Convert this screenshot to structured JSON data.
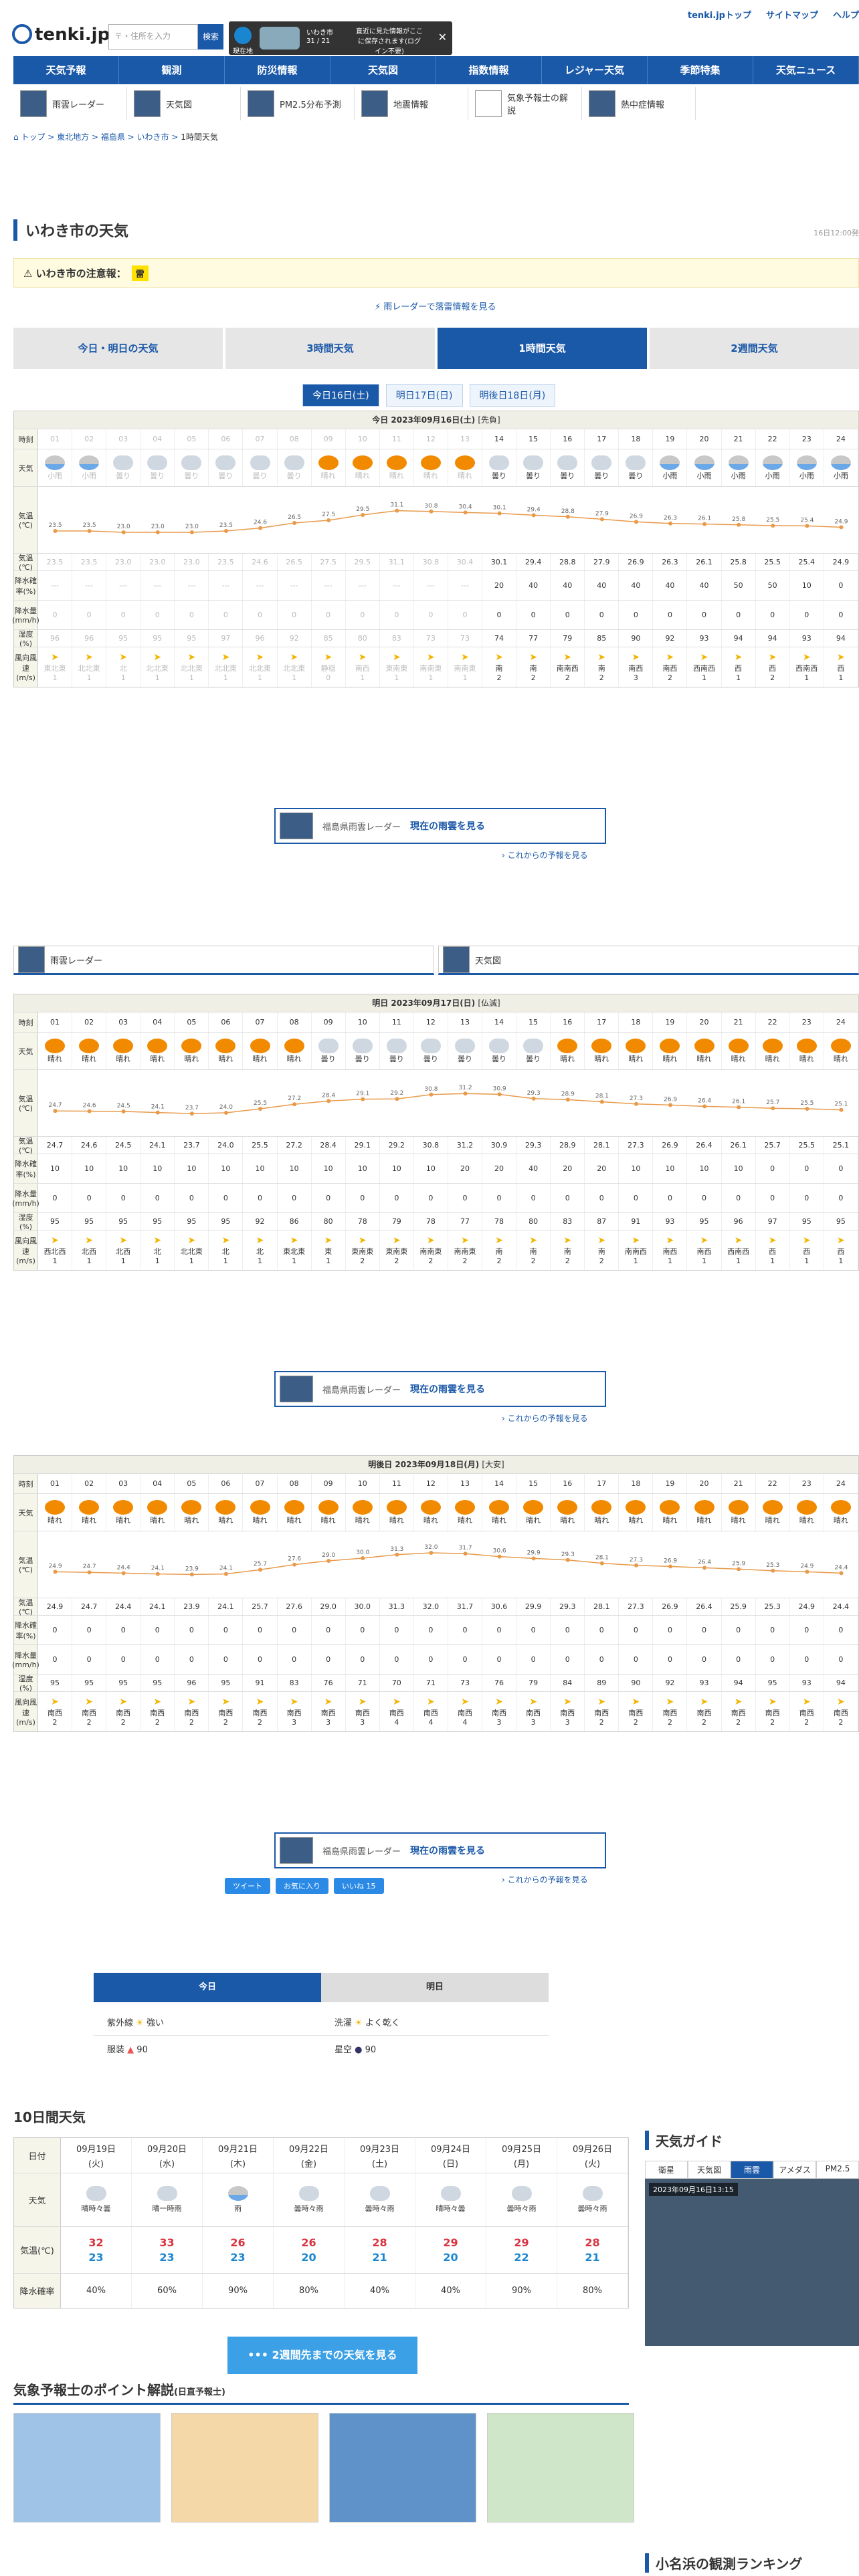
{
  "header": {
    "logo": "tenki.jp",
    "search_placeholder": "〒・住所を入力",
    "search_btn": "検索",
    "curloc_label": "現在地",
    "curloc_city": "いわき市",
    "curloc_temp": "31 / 21",
    "save_msg": "直近に見た情報がここに保存されます(ログイン不要)",
    "links": [
      "tenki.jpトップ",
      "サイトマップ",
      "ヘルプ"
    ]
  },
  "gnav": [
    "天気予報",
    "観測",
    "防災情報",
    "天気図",
    "指数情報",
    "レジャー天気",
    "季節特集",
    "天気ニュース"
  ],
  "snav": [
    "雨雲レーダー",
    "天気図",
    "PM2.5分布予測",
    "地震情報",
    "気象予報士の解説",
    "熱中症情報"
  ],
  "breadcrumb": [
    "トップ",
    "東北地方",
    "福島県",
    "いわき市",
    "1時間天気"
  ],
  "page": {
    "title": "いわき市の天気",
    "updated": "16日12:00発",
    "warn_label": "いわき市の注意報：",
    "warn_badge": "雷",
    "radar_link": "雨レーダーで落雷情報を見る"
  },
  "tabs": [
    "今日・明日の天気",
    "3時間天気",
    "1時間天気",
    "2週間天気"
  ],
  "day_tabs": [
    "今日16日(土)",
    "明日17日(日)",
    "明後日18日(月)"
  ],
  "row_labels": {
    "time": "時刻",
    "weather": "天気",
    "temp": "気温(℃)",
    "prob": "降水確率(%)",
    "precip": "降水量(mm/h)",
    "humid": "湿度(%)",
    "wind": "風向風速(m/s)"
  },
  "hours": [
    "01",
    "02",
    "03",
    "04",
    "05",
    "06",
    "07",
    "08",
    "09",
    "10",
    "11",
    "12",
    "13",
    "14",
    "15",
    "16",
    "17",
    "18",
    "19",
    "20",
    "21",
    "22",
    "23",
    "24"
  ],
  "days": [
    {
      "title": "今日 2023年09月16日(土)",
      "rokuyo": "[先負]",
      "past_until": 13,
      "weather": [
        "小雨",
        "小雨",
        "曇り",
        "曇り",
        "曇り",
        "曇り",
        "曇り",
        "曇り",
        "晴れ",
        "晴れ",
        "晴れ",
        "晴れ",
        "晴れ",
        "曇り",
        "曇り",
        "曇り",
        "曇り",
        "曇り",
        "小雨",
        "小雨",
        "小雨",
        "小雨",
        "小雨",
        "小雨"
      ],
      "temp": [
        "23.5",
        "23.5",
        "23.0",
        "23.0",
        "23.0",
        "23.5",
        "24.6",
        "26.5",
        "27.5",
        "29.5",
        "31.1",
        "30.8",
        "30.4",
        "30.1",
        "29.4",
        "28.8",
        "27.9",
        "26.9",
        "26.3",
        "26.1",
        "25.8",
        "25.5",
        "25.4",
        "24.9"
      ],
      "prob": [
        "---",
        "---",
        "---",
        "---",
        "---",
        "---",
        "---",
        "---",
        "---",
        "---",
        "---",
        "---",
        "---",
        "20",
        "40",
        "40",
        "40",
        "40",
        "40",
        "40",
        "50",
        "50",
        "10",
        "0"
      ],
      "precip": [
        "0",
        "0",
        "0",
        "0",
        "0",
        "0",
        "0",
        "0",
        "0",
        "0",
        "0",
        "0",
        "0",
        "0",
        "0",
        "0",
        "0",
        "0",
        "0",
        "0",
        "0",
        "0",
        "0",
        "0"
      ],
      "humid": [
        "96",
        "96",
        "95",
        "95",
        "95",
        "97",
        "96",
        "92",
        "85",
        "80",
        "83",
        "73",
        "73",
        "74",
        "77",
        "79",
        "85",
        "90",
        "92",
        "93",
        "94",
        "94",
        "93",
        "94"
      ],
      "wdir": [
        "東北東",
        "北北東",
        "北",
        "北北東",
        "北北東",
        "北北東",
        "北北東",
        "北北東",
        "静穏",
        "南西",
        "東南東",
        "南南東",
        "南南東",
        "南",
        "南",
        "南南西",
        "南",
        "南西",
        "南西",
        "西南西",
        "西",
        "西",
        "西南西",
        "西"
      ],
      "wspd": [
        "1",
        "1",
        "1",
        "1",
        "1",
        "1",
        "1",
        "1",
        "0",
        "1",
        "1",
        "1",
        "1",
        "2",
        "2",
        "2",
        "2",
        "3",
        "2",
        "1",
        "1",
        "2",
        "1",
        "1"
      ]
    },
    {
      "title": "明日 2023年09月17日(日)",
      "rokuyo": "[仏滅]",
      "past_until": 0,
      "weather": [
        "晴れ",
        "晴れ",
        "晴れ",
        "晴れ",
        "晴れ",
        "晴れ",
        "晴れ",
        "晴れ",
        "曇り",
        "曇り",
        "曇り",
        "曇り",
        "曇り",
        "曇り",
        "曇り",
        "晴れ",
        "晴れ",
        "晴れ",
        "晴れ",
        "晴れ",
        "晴れ",
        "晴れ",
        "晴れ",
        "晴れ"
      ],
      "temp": [
        "24.7",
        "24.6",
        "24.5",
        "24.1",
        "23.7",
        "24.0",
        "25.5",
        "27.2",
        "28.4",
        "29.1",
        "29.2",
        "30.8",
        "31.2",
        "30.9",
        "29.3",
        "28.9",
        "28.1",
        "27.3",
        "26.9",
        "26.4",
        "26.1",
        "25.7",
        "25.5",
        "25.1"
      ],
      "prob": [
        "10",
        "10",
        "10",
        "10",
        "10",
        "10",
        "10",
        "10",
        "10",
        "10",
        "10",
        "10",
        "20",
        "20",
        "40",
        "20",
        "20",
        "10",
        "10",
        "10",
        "10",
        "0",
        "0",
        "0"
      ],
      "precip": [
        "0",
        "0",
        "0",
        "0",
        "0",
        "0",
        "0",
        "0",
        "0",
        "0",
        "0",
        "0",
        "0",
        "0",
        "0",
        "0",
        "0",
        "0",
        "0",
        "0",
        "0",
        "0",
        "0",
        "0"
      ],
      "humid": [
        "95",
        "95",
        "95",
        "95",
        "95",
        "95",
        "92",
        "86",
        "80",
        "78",
        "79",
        "78",
        "77",
        "78",
        "80",
        "83",
        "87",
        "91",
        "93",
        "95",
        "96",
        "97",
        "95",
        "95"
      ],
      "wdir": [
        "西北西",
        "北西",
        "北西",
        "北",
        "北北東",
        "北",
        "北",
        "東北東",
        "東",
        "東南東",
        "東南東",
        "南南東",
        "南南東",
        "南",
        "南",
        "南",
        "南",
        "南南西",
        "南西",
        "南西",
        "西南西",
        "西",
        "西",
        "西"
      ],
      "wspd": [
        "1",
        "1",
        "1",
        "1",
        "1",
        "1",
        "1",
        "1",
        "1",
        "2",
        "2",
        "2",
        "2",
        "2",
        "2",
        "2",
        "2",
        "1",
        "1",
        "1",
        "1",
        "1",
        "1",
        "1"
      ]
    },
    {
      "title": "明後日 2023年09月18日(月)",
      "rokuyo": "[大安]",
      "past_until": 0,
      "weather": [
        "晴れ",
        "晴れ",
        "晴れ",
        "晴れ",
        "晴れ",
        "晴れ",
        "晴れ",
        "晴れ",
        "晴れ",
        "晴れ",
        "晴れ",
        "晴れ",
        "晴れ",
        "晴れ",
        "晴れ",
        "晴れ",
        "晴れ",
        "晴れ",
        "晴れ",
        "晴れ",
        "晴れ",
        "晴れ",
        "晴れ",
        "晴れ"
      ],
      "temp": [
        "24.9",
        "24.7",
        "24.4",
        "24.1",
        "23.9",
        "24.1",
        "25.7",
        "27.6",
        "29.0",
        "30.0",
        "31.3",
        "32.0",
        "31.7",
        "30.6",
        "29.9",
        "29.3",
        "28.1",
        "27.3",
        "26.9",
        "26.4",
        "25.9",
        "25.3",
        "24.9",
        "24.4"
      ],
      "prob": [
        "0",
        "0",
        "0",
        "0",
        "0",
        "0",
        "0",
        "0",
        "0",
        "0",
        "0",
        "0",
        "0",
        "0",
        "0",
        "0",
        "0",
        "0",
        "0",
        "0",
        "0",
        "0",
        "0",
        "0"
      ],
      "precip": [
        "0",
        "0",
        "0",
        "0",
        "0",
        "0",
        "0",
        "0",
        "0",
        "0",
        "0",
        "0",
        "0",
        "0",
        "0",
        "0",
        "0",
        "0",
        "0",
        "0",
        "0",
        "0",
        "0",
        "0"
      ],
      "humid": [
        "95",
        "95",
        "95",
        "95",
        "96",
        "95",
        "91",
        "83",
        "76",
        "71",
        "70",
        "71",
        "73",
        "76",
        "79",
        "84",
        "89",
        "90",
        "92",
        "93",
        "94",
        "95",
        "93",
        "94"
      ],
      "wdir": [
        "南西",
        "南西",
        "南西",
        "南西",
        "南西",
        "南西",
        "南西",
        "南西",
        "南西",
        "南西",
        "南西",
        "南西",
        "南西",
        "南西",
        "南西",
        "南西",
        "南西",
        "南西",
        "南西",
        "南西",
        "南西",
        "南西",
        "南西",
        "南西"
      ],
      "wspd": [
        "2",
        "2",
        "2",
        "2",
        "2",
        "2",
        "2",
        "3",
        "3",
        "3",
        "4",
        "4",
        "4",
        "3",
        "3",
        "3",
        "2",
        "2",
        "2",
        "2",
        "2",
        "2",
        "2",
        "2"
      ]
    }
  ],
  "mapbtn": {
    "caption": "福島県雨雲レーダー",
    "label": "現在の雨雲を見る",
    "more": "これからの予報を見る"
  },
  "share": [
    "ツイート",
    "お気に入り",
    "いいね 15"
  ],
  "index": {
    "tabs": [
      "今日",
      "明日"
    ],
    "items": [
      {
        "k": "紫外線",
        "v": "強い"
      },
      {
        "k": "洗濯",
        "v": "よく乾く"
      },
      {
        "k": "服装",
        "v": "90"
      },
      {
        "k": "星空",
        "v": "90"
      }
    ]
  },
  "ten_day": {
    "title": "10日間天気",
    "labels": [
      "日付",
      "天気",
      "気温(℃)",
      "降水確率"
    ],
    "items": [
      {
        "d": "09月19日",
        "w": "(火)",
        "wx": "晴時々曇",
        "hi": "32",
        "lo": "23",
        "p": "40%"
      },
      {
        "d": "09月20日",
        "w": "(水)",
        "wx": "晴一時雨",
        "hi": "33",
        "lo": "23",
        "p": "60%"
      },
      {
        "d": "09月21日",
        "w": "(木)",
        "wx": "雨",
        "hi": "26",
        "lo": "23",
        "p": "90%"
      },
      {
        "d": "09月22日",
        "w": "(金)",
        "wx": "曇時々雨",
        "hi": "26",
        "lo": "20",
        "p": "80%"
      },
      {
        "d": "09月23日",
        "w": "(土)",
        "wx": "曇時々雨",
        "hi": "28",
        "lo": "21",
        "p": "40%"
      },
      {
        "d": "09月24日",
        "w": "(日)",
        "wx": "晴時々曇",
        "hi": "29",
        "lo": "20",
        "p": "40%"
      },
      {
        "d": "09月25日",
        "w": "(月)",
        "wx": "曇時々雨",
        "hi": "29",
        "lo": "22",
        "p": "90%"
      },
      {
        "d": "09月26日",
        "w": "(火)",
        "wx": "曇時々雨",
        "hi": "28",
        "lo": "21",
        "p": "80%"
      }
    ],
    "btn": "2週間先までの天気を見る"
  },
  "guide": {
    "title": "天気ガイド",
    "tabs": [
      "衛星",
      "天気図",
      "雨雲",
      "アメダス",
      "PM2.5"
    ],
    "stamp": "2023年09月16日13:15"
  },
  "points": {
    "title": "気象予報士のポイント解説",
    "sub": "(日直予報士)"
  },
  "ranking": {
    "title": "小名浜の観測ランキング"
  }
}
